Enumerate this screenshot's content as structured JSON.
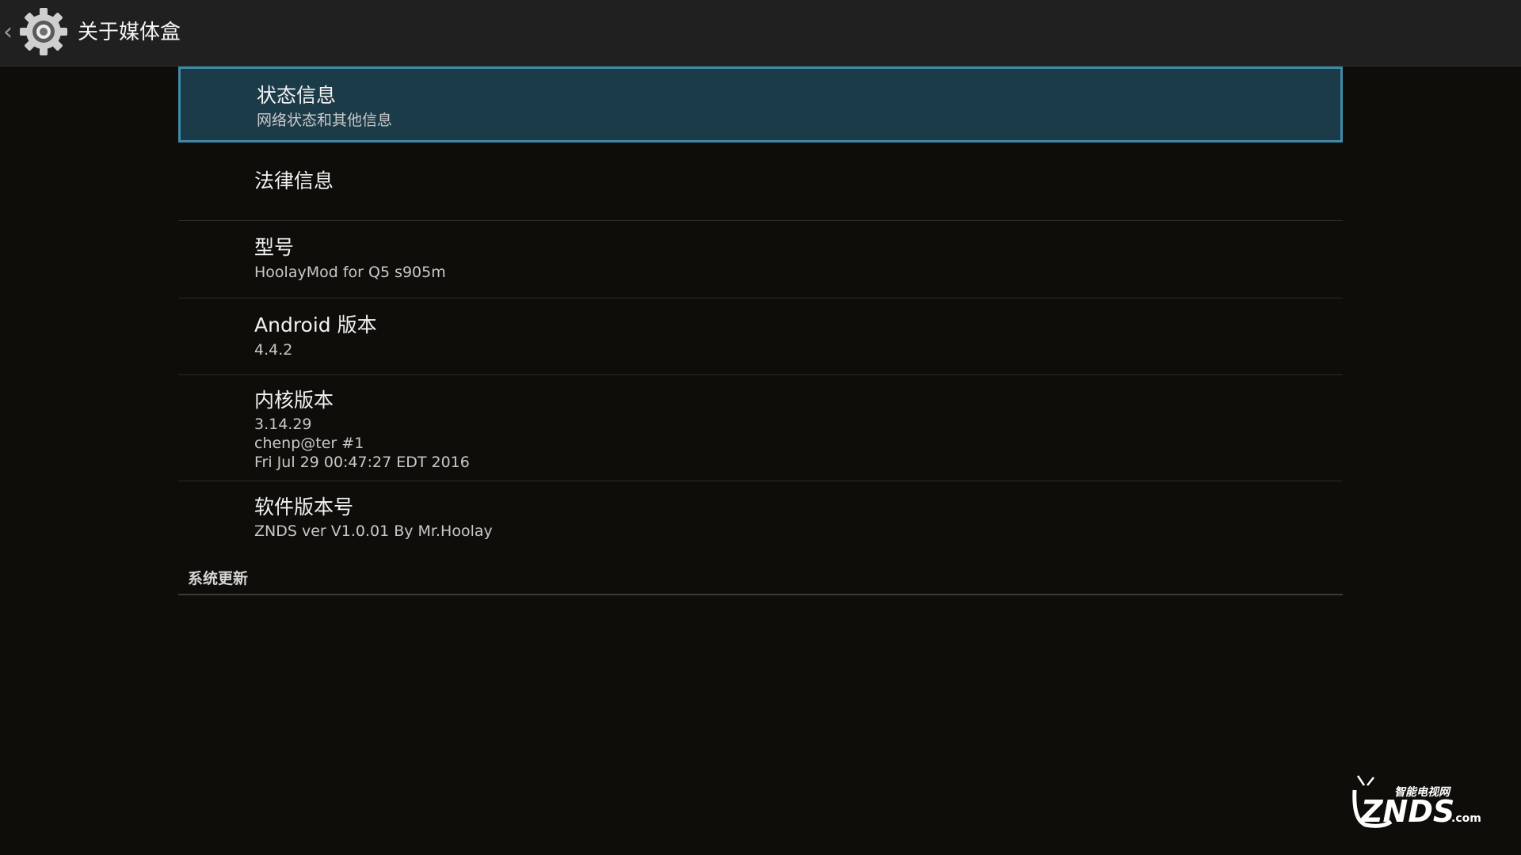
{
  "header": {
    "back_glyph": "‹",
    "icon": "gear-icon",
    "title": "关于媒体盒"
  },
  "items": [
    {
      "title": "状态信息",
      "subtitle": "网络状态和其他信息",
      "selected": true
    },
    {
      "title": "法律信息"
    },
    {
      "title": "型号",
      "subtitle": "HoolayMod for  Q5 s905m"
    },
    {
      "title": "Android 版本",
      "subtitle": "4.4.2"
    },
    {
      "title": "内核版本",
      "subtitle_lines": [
        "3.14.29",
        "chenp@ter #1",
        "Fri Jul 29 00:47:27 EDT 2016"
      ]
    },
    {
      "title": "软件版本号",
      "subtitle": "ZNDS ver V1.0.01 By Mr.Hoolay"
    }
  ],
  "section": {
    "system_update": "系统更新"
  },
  "watermark": {
    "brand": "ZNDS",
    "suffix": ".com",
    "tagline": "智能电视网"
  },
  "colors": {
    "background": "#0e0d09",
    "action_bar": "#202020",
    "selected_fill": "#1c3b48",
    "selected_border": "#3e8aa8"
  }
}
